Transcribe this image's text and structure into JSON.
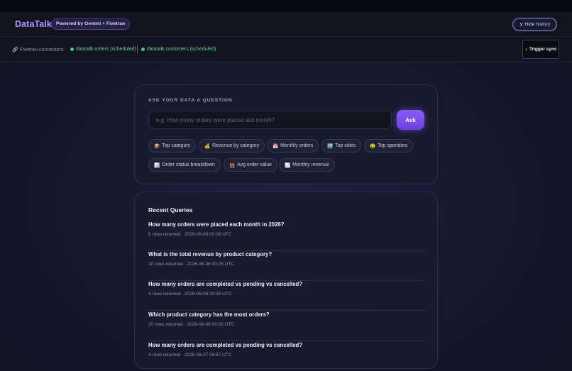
{
  "header": {
    "brand": "DataTalk",
    "powered_badge": "Powered by Gemini + Fivetran",
    "hide_history_label": "Hide history"
  },
  "connectors": {
    "label": "Fivetran connectors:",
    "items": [
      {
        "name": "datatalk.orders (scheduled)"
      },
      {
        "name": "datatalk.customers (scheduled)"
      }
    ],
    "trigger_label": "Trigger sync",
    "status_color": "#3fcf7e"
  },
  "ask": {
    "title": "ASK YOUR DATA A QUESTION",
    "placeholder": "e.g. How many orders were placed last month?",
    "button_label": "Ask",
    "suggestions": [
      {
        "icon": "📦",
        "label": "Top category"
      },
      {
        "icon": "💰",
        "label": "Revenue by category"
      },
      {
        "icon": "📅",
        "label": "Monthly orders"
      },
      {
        "icon": "🏙️",
        "label": "Top cities"
      },
      {
        "icon": "🤑",
        "label": "Top spenders"
      },
      {
        "icon": "📊",
        "label": "Order status breakdown"
      },
      {
        "icon": "🧮",
        "label": "Avg order value"
      },
      {
        "icon": "📈",
        "label": "Monthly revenue"
      }
    ]
  },
  "recent": {
    "title": "Recent Queries",
    "items": [
      {
        "question": "How many orders were placed each month in 2026?",
        "meta": "6 rows returned · 2026-06-08 00:06 UTC"
      },
      {
        "question": "What is the total revenue by product category?",
        "meta": "10 rows returned · 2026-06-08 00:05 UTC"
      },
      {
        "question": "How many orders are completed vs pending vs cancelled?",
        "meta": "4 rows returned · 2026-06-08 00:05 UTC"
      },
      {
        "question": "Which product category has the most orders?",
        "meta": "10 rows returned · 2026-06-08 00:03 UTC"
      },
      {
        "question": "How many orders are completed vs pending vs cancelled?",
        "meta": "4 rows returned · 2026-06-07 08:57 UTC"
      }
    ]
  },
  "colors": {
    "accent": "#8a5cf6",
    "brand": "#a996ff",
    "connector_green": "#5ad28e"
  }
}
